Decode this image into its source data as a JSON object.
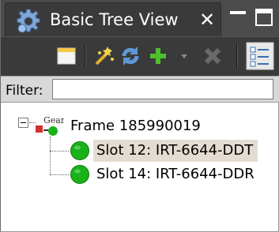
{
  "window": {
    "tab_title": "Basic Tree View",
    "tab_close_glyph": "✕",
    "tab_icon": "gear-icon"
  },
  "toolbar": {
    "buttons": [
      {
        "name": "new-window-button",
        "icon": "new-window-icon"
      },
      {
        "name": "wand-button",
        "icon": "wand-icon"
      },
      {
        "name": "refresh-button",
        "icon": "refresh-icon"
      },
      {
        "name": "add-button",
        "icon": "plus-icon"
      },
      {
        "name": "add-dropdown-button",
        "icon": "chevron-down-icon"
      },
      {
        "name": "remove-button",
        "icon": "close-icon",
        "disabled": true
      },
      {
        "name": "view-toggle-button",
        "icon": "tree-view-icon",
        "active": true
      }
    ]
  },
  "filter": {
    "label": "Filter:",
    "value": "",
    "placeholder": ""
  },
  "tree": {
    "root": {
      "label": "Frame 185990019",
      "icon_text": "Gear",
      "expanded": true
    },
    "children": [
      {
        "label": "Slot 12: IRT-6644-DDT",
        "status_color": "#19b219",
        "selected": true
      },
      {
        "label": "Slot 14: IRT-6644-DDR",
        "status_color": "#19b219",
        "selected": false
      }
    ]
  },
  "colors": {
    "titlebar": "#4b4b4b",
    "toolbar": "#3a3a3a",
    "selection": "#e4dcd2",
    "status_ok": "#19b219"
  }
}
